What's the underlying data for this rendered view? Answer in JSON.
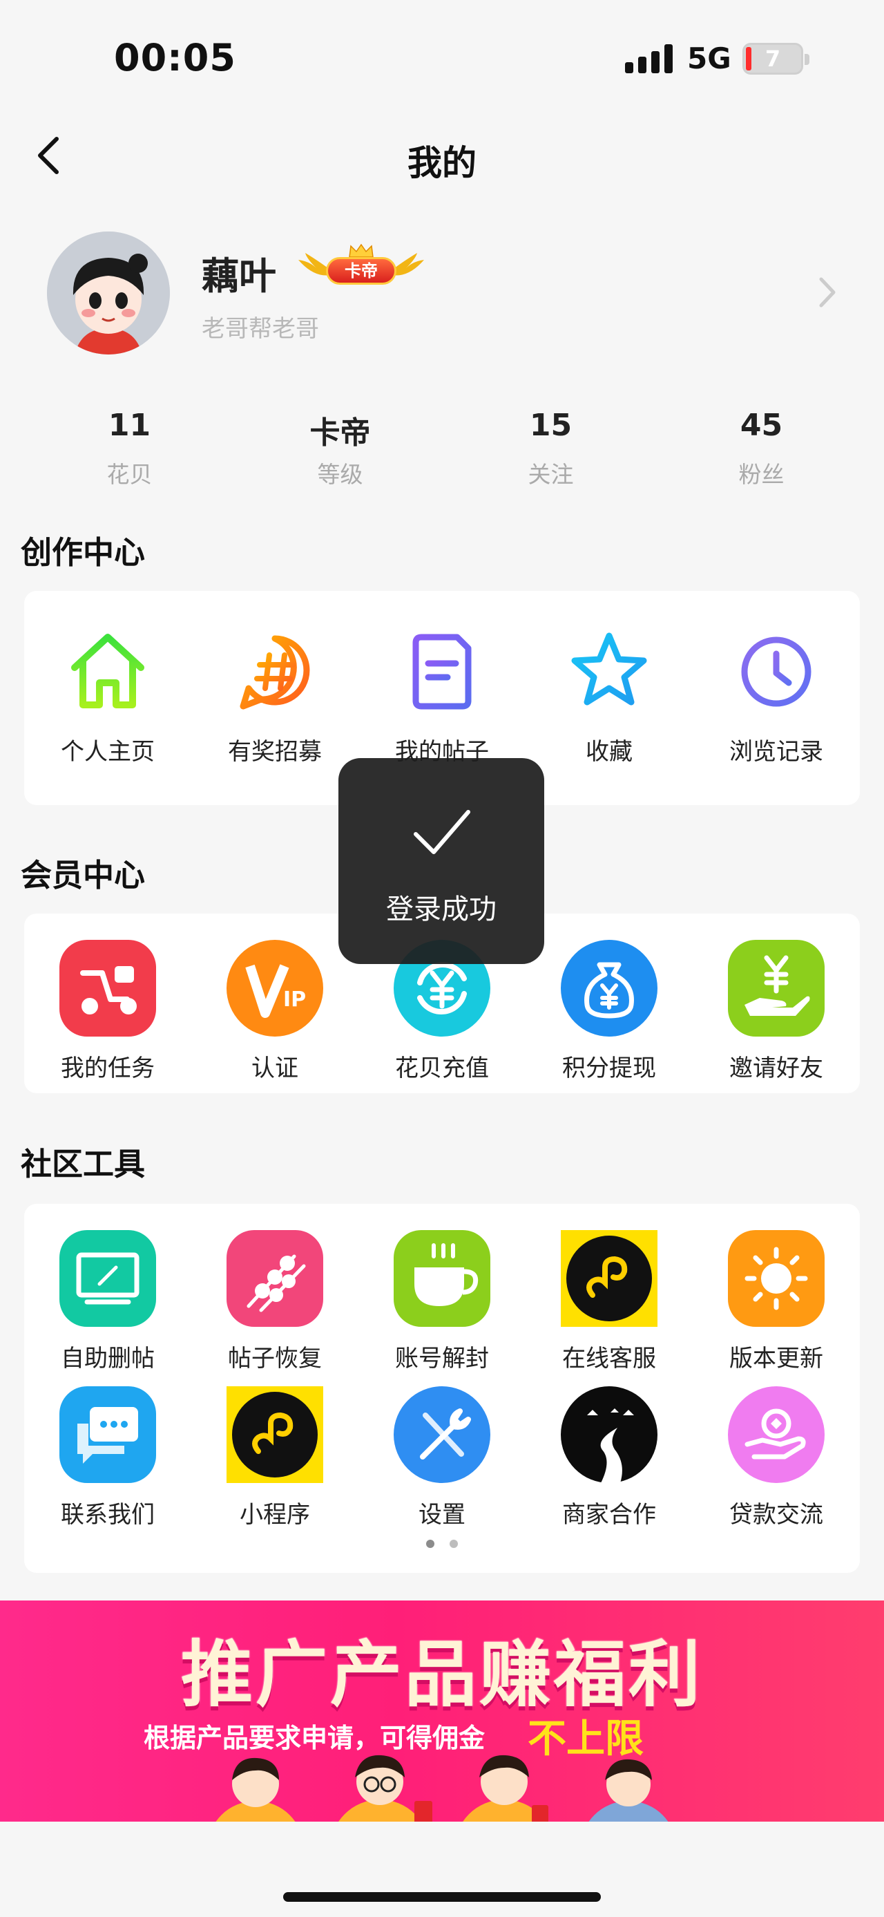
{
  "status_bar": {
    "time": "00:05",
    "network": "5G",
    "battery": "7"
  },
  "header": {
    "title": "我的"
  },
  "profile": {
    "username": "藕叶",
    "level_badge": "卡帝",
    "subtitle": "老哥帮老哥"
  },
  "stats": [
    {
      "value": "11",
      "label": "花贝"
    },
    {
      "value": "卡帝",
      "label": "等级"
    },
    {
      "value": "15",
      "label": "关注"
    },
    {
      "value": "45",
      "label": "粉丝"
    }
  ],
  "creation_center": {
    "title": "创作中心",
    "items": [
      {
        "label": "个人主页",
        "icon": "home-icon"
      },
      {
        "label": "有奖招募",
        "icon": "hashtag-bubble-icon"
      },
      {
        "label": "我的帖子",
        "icon": "document-icon"
      },
      {
        "label": "收藏",
        "icon": "star-icon"
      },
      {
        "label": "浏览记录",
        "icon": "clock-icon"
      }
    ]
  },
  "member_center": {
    "title": "会员中心",
    "items": [
      {
        "label": "我的任务",
        "icon": "scooter-icon"
      },
      {
        "label": "认证",
        "icon": "vip-icon"
      },
      {
        "label": "花贝充值",
        "icon": "yen-refresh-icon"
      },
      {
        "label": "积分提现",
        "icon": "money-bag-icon"
      },
      {
        "label": "邀请好友",
        "icon": "yen-hand-icon"
      }
    ]
  },
  "community_tools": {
    "title": "社区工具",
    "items": [
      {
        "label": "自助删帖",
        "icon": "monitor-edit-icon"
      },
      {
        "label": "帖子恢复",
        "icon": "skewers-icon"
      },
      {
        "label": "账号解封",
        "icon": "coffee-cup-icon"
      },
      {
        "label": "在线客服",
        "icon": "mini-program-icon"
      },
      {
        "label": "版本更新",
        "icon": "sun-icon"
      },
      {
        "label": "联系我们",
        "icon": "chat-bubbles-icon"
      },
      {
        "label": "小程序",
        "icon": "mini-program-icon"
      },
      {
        "label": "设置",
        "icon": "tools-icon"
      },
      {
        "label": "商家合作",
        "icon": "road-landscape-icon"
      },
      {
        "label": "贷款交流",
        "icon": "hand-coin-icon"
      }
    ],
    "page_count": 2,
    "current_page": 1
  },
  "toast": {
    "text": "登录成功"
  },
  "banner": {
    "title": "推广产品赚福利",
    "subtitle": "根据产品要求申请，可得佣金",
    "accent": "不上限"
  },
  "colors": {
    "background": "#f6f6f6",
    "card": "#ffffff",
    "banner": "#ff1f78",
    "banner_accent": "#ffe21a"
  }
}
